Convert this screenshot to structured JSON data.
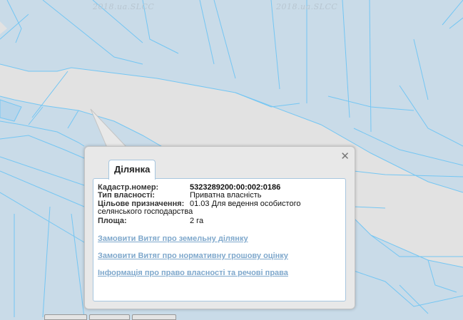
{
  "map": {
    "watermarks": [
      "2018.ua.SLCC",
      "2018.ua.SLCC"
    ]
  },
  "popup": {
    "close_icon": "close-icon",
    "tab_label": "Ділянка",
    "fields": [
      {
        "label": "Кадастр.номер:",
        "value": "5323289200:00:002:0186"
      },
      {
        "label": "Тип власності:",
        "value": "Приватна власність"
      },
      {
        "label": "Цільове призначення:",
        "value": "01.03 Для ведення особистого селянського господарства"
      },
      {
        "label": "Площа:",
        "value": "2 га"
      }
    ],
    "links": [
      "Замовити Витяг про земельну ділянку",
      "Замовити Витяг про нормативну грошову оцінку",
      "Інформація про право власності та речові права"
    ]
  },
  "colors": {
    "parcel_fill": "#c9dbe8",
    "parcel_line": "#74c6f3",
    "road": "#e2e2e2",
    "link": "#7fa8cc"
  }
}
